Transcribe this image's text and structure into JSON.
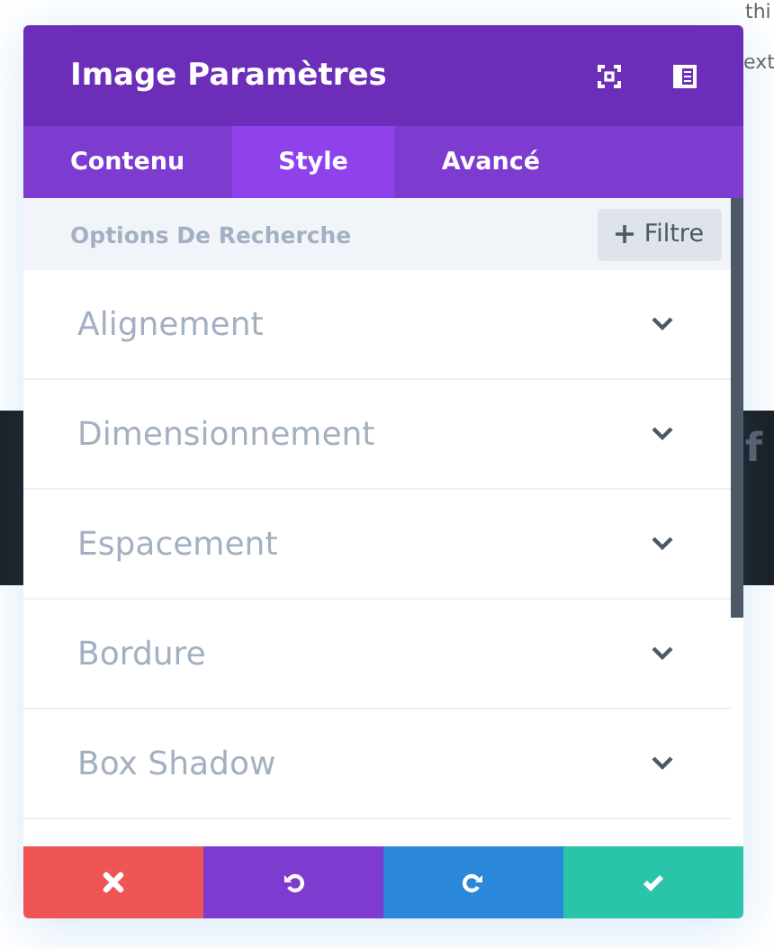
{
  "background": {
    "lines": [
      "thi"
    ],
    "edge_text": "ext",
    "band_glyph": "f"
  },
  "window": {
    "title": "Image Paramètres"
  },
  "tabs": [
    {
      "label": "Contenu",
      "selected": false
    },
    {
      "label": "Style",
      "selected": true
    },
    {
      "label": "Avancé",
      "selected": false
    }
  ],
  "search": {
    "placeholder": "Options De Recherche",
    "filter_button": "Filtre"
  },
  "sections": [
    {
      "label": "Alignement",
      "expanded": false
    },
    {
      "label": "Dimensionnement",
      "expanded": false
    },
    {
      "label": "Espacement",
      "expanded": false
    },
    {
      "label": "Bordure",
      "expanded": false
    },
    {
      "label": "Box Shadow",
      "expanded": false
    }
  ],
  "footer_buttons": [
    {
      "kind": "cancel",
      "color": "#ef5555"
    },
    {
      "kind": "undo",
      "color": "#7e3bd0"
    },
    {
      "kind": "redo",
      "color": "#2b87da"
    },
    {
      "kind": "save",
      "color": "#29c4a9"
    }
  ]
}
